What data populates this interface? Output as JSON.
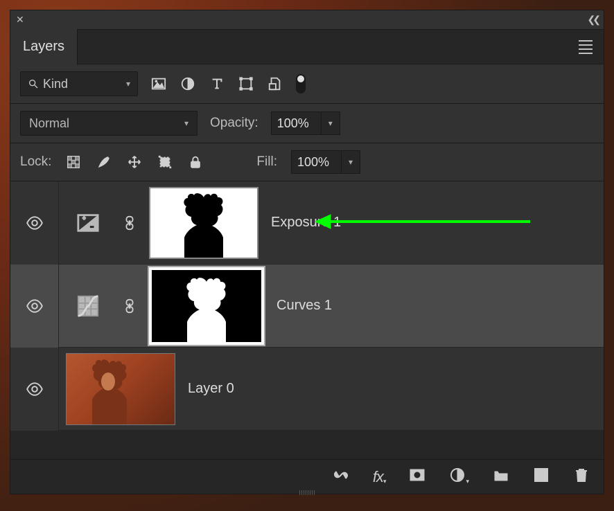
{
  "panel": {
    "tab_label": "Layers"
  },
  "filter_row": {
    "kind_label": "Kind"
  },
  "blend_row": {
    "mode_label": "Normal",
    "opacity_label": "Opacity:",
    "opacity_value": "100%"
  },
  "lock_row": {
    "lock_label": "Lock:",
    "fill_label": "Fill:",
    "fill_value": "100%"
  },
  "layers": [
    {
      "name": "Exposure 1",
      "type": "exposure",
      "mask": "white-bg-black-figure",
      "selected": false
    },
    {
      "name": "Curves 1",
      "type": "curves",
      "mask": "black-bg-white-figure",
      "selected": true
    },
    {
      "name": "Layer 0",
      "type": "pixel",
      "selected": false
    }
  ],
  "annotation": {
    "color": "#00ff00"
  }
}
